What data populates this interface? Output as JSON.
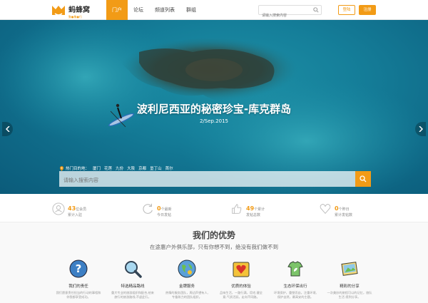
{
  "header": {
    "logo_text": "蚂蜂窝",
    "logo_sub": "聚●集●行",
    "nav": [
      {
        "label": "门户",
        "active": true
      },
      {
        "label": "论坛",
        "active": false
      },
      {
        "label": "频道列表",
        "active": false
      },
      {
        "label": "群组",
        "active": false
      }
    ],
    "search_placeholder": "请输入搜索内容",
    "login_label": "登陆",
    "register_label": "注册",
    "accent_color": "#f29b16"
  },
  "hero": {
    "title": "波利尼西亚的秘密珍宝-库克群岛",
    "date": "2/Sep.2015",
    "hot_label": "热门目的地：",
    "hot_tags": [
      "厦门",
      "花莲",
      "九份",
      "大阪",
      "京都",
      "垦丁山",
      "首尔"
    ],
    "search_placeholder": "请输入搜索内容",
    "slides": 4,
    "active_slide": 2
  },
  "stats": [
    {
      "value": "43",
      "unit": "位会员",
      "label": "累计入驻",
      "icon": "user-icon"
    },
    {
      "value": "0",
      "unit": "个最新",
      "label": "今日发帖",
      "icon": "refresh-icon"
    },
    {
      "value": "49",
      "unit": "个累计",
      "label": "发帖总数",
      "icon": "thumbs-up-icon"
    },
    {
      "value": "0",
      "unit": "个昨日",
      "label": "累计发帖数",
      "icon": "heart-icon"
    }
  ],
  "advantages": {
    "title": "我们的优势",
    "subtitle": "在途惠户外俱乐部，只有你想不到，绝没有我们做不到",
    "features": [
      {
        "title": "我们的责任",
        "desc": "我们愿意责任担当的行动的事相和你我都享受成功。",
        "icon": "question-icon"
      },
      {
        "title": "特选精品路线",
        "desc": "重大专业的旅游组织和配合,给来旅行的旅游路线,不虚此行。",
        "icon": "magnifier-icon"
      },
      {
        "title": "金牌服务",
        "desc": "热情的服务团队，周边声望有人,专备致力的团队组织。",
        "icon": "globe-icon"
      },
      {
        "title": "优质的体验",
        "desc": "品味生活，一路行满，用宅,健全意,气质活跃。走向不同路。",
        "icon": "heart-box-icon"
      },
      {
        "title": "生态环保出行",
        "desc": "环境保护，重塑而自。注重环境,保护自然，最高安的主题。",
        "icon": "leaf-shirt-icon"
      },
      {
        "title": "精彩的分享",
        "desc": "一次美妙的旅程可以的记忆，旅队生活 感到分享。",
        "icon": "photo-icon"
      }
    ]
  }
}
